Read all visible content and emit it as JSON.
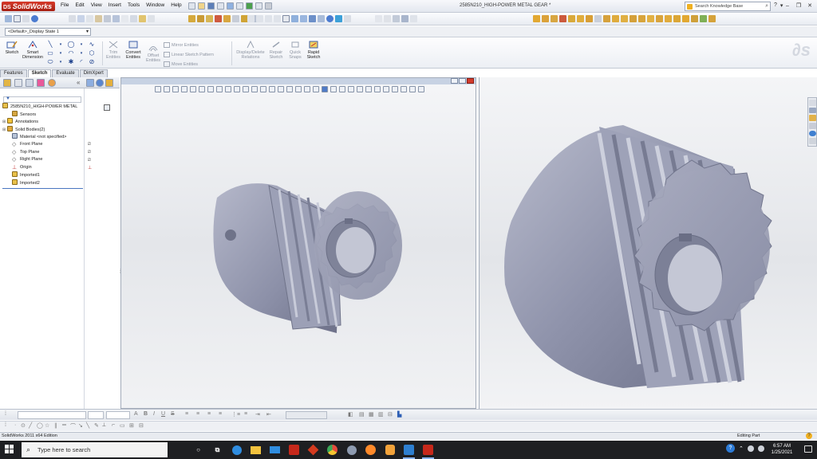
{
  "app": {
    "name": "SolidWorks",
    "document_title": "2585N210_HIGH-POWER METAL GEAR *"
  },
  "menu": [
    "File",
    "Edit",
    "View",
    "Insert",
    "Tools",
    "Window",
    "Help"
  ],
  "search": {
    "placeholder": "Search Knowledge Base"
  },
  "configuration": {
    "selected": "<Default>_Display State 1"
  },
  "command_manager": {
    "sketch": "Sketch",
    "smart_dimension_1": "Smart",
    "smart_dimension_2": "Dimension",
    "trim_1": "Trim",
    "trim_2": "Entities",
    "convert_1": "Convert",
    "convert_2": "Entities",
    "offset_1": "Offset",
    "offset_2": "Entities",
    "mirror": "Mirror Entities",
    "linear_pattern": "Linear Sketch Pattern",
    "move": "Move Entities",
    "display_delete_1": "Display/Delete",
    "display_delete_2": "Relations",
    "repair_1": "Repair",
    "repair_2": "Sketch",
    "quick_snaps_1": "Quick",
    "quick_snaps_2": "Snaps",
    "rapid_1": "Rapid",
    "rapid_2": "Sketch"
  },
  "tabs": [
    {
      "label": "Features"
    },
    {
      "label": "Sketch"
    },
    {
      "label": "Evaluate"
    },
    {
      "label": "DimXpert"
    }
  ],
  "feature_tree": {
    "root": "2585N210_HIGH-POWER METAL",
    "items": [
      {
        "label": "Sensors"
      },
      {
        "label": "Annotations"
      },
      {
        "label": "Solid Bodies(2)"
      },
      {
        "label": "Material <not specified>"
      },
      {
        "label": "Front Plane"
      },
      {
        "label": "Top Plane"
      },
      {
        "label": "Right Plane"
      },
      {
        "label": "Origin"
      },
      {
        "label": "Imported1"
      },
      {
        "label": "Imported2"
      }
    ]
  },
  "status_bar": {
    "edition": "SolidWorks 2011 x64 Edition",
    "state": "Editing Part"
  },
  "taskbar": {
    "search_placeholder": "Type here to search",
    "time": "6:57 AM",
    "date": "1/25/2021"
  },
  "colors": {
    "gear_base": "#9a9eb5",
    "gear_light": "#c5c8d8",
    "gear_dark": "#6b6f86",
    "accent": "#4f7bc7"
  }
}
